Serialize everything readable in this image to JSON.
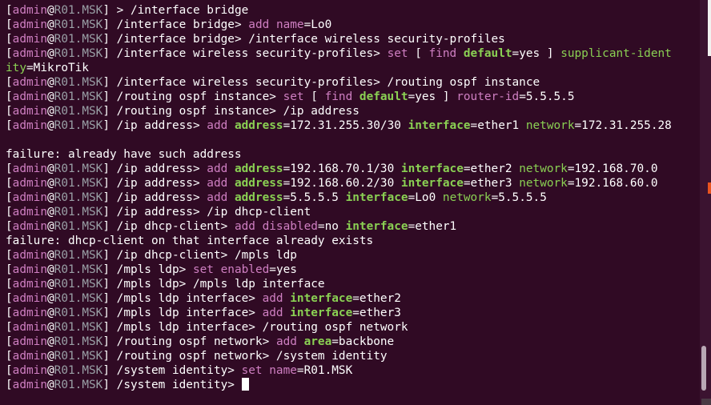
{
  "window": {
    "colors": {
      "background": "#300a24",
      "user": "#cf7fc2",
      "host": "#9aa0a6",
      "keyword": "#8ad053",
      "text": "#ffffff"
    }
  },
  "terminal": {
    "lines": [
      [
        [
          "w",
          "["
        ],
        [
          "u",
          "admin"
        ],
        [
          "w",
          "@"
        ],
        [
          "h",
          "R01.MSK"
        ],
        [
          "w",
          "] > /interface bridge"
        ]
      ],
      [
        [
          "w",
          "["
        ],
        [
          "u",
          "admin"
        ],
        [
          "w",
          "@"
        ],
        [
          "h",
          "R01.MSK"
        ],
        [
          "w",
          "] /interface bridge> "
        ],
        [
          "u",
          "add "
        ],
        [
          "u",
          "name"
        ],
        [
          "w",
          "=Lo0"
        ]
      ],
      [
        [
          "w",
          "["
        ],
        [
          "u",
          "admin"
        ],
        [
          "w",
          "@"
        ],
        [
          "h",
          "R01.MSK"
        ],
        [
          "w",
          "] /interface bridge> /interface wireless security-profiles"
        ]
      ],
      [
        [
          "w",
          "["
        ],
        [
          "u",
          "admin"
        ],
        [
          "w",
          "@"
        ],
        [
          "h",
          "R01.MSK"
        ],
        [
          "w",
          "] /interface wireless security-profiles> "
        ],
        [
          "u",
          "set "
        ],
        [
          "w",
          "[ "
        ],
        [
          "u",
          "find "
        ],
        [
          "k",
          "default"
        ],
        [
          "w",
          "=yes ] "
        ],
        [
          "g",
          "supplicant-ident"
        ]
      ],
      [
        [
          "g",
          "ity"
        ],
        [
          "w",
          "=MikroTik"
        ]
      ],
      [
        [
          "w",
          "["
        ],
        [
          "u",
          "admin"
        ],
        [
          "w",
          "@"
        ],
        [
          "h",
          "R01.MSK"
        ],
        [
          "w",
          "] /interface wireless security-profiles> /routing ospf instance"
        ]
      ],
      [
        [
          "w",
          "["
        ],
        [
          "u",
          "admin"
        ],
        [
          "w",
          "@"
        ],
        [
          "h",
          "R01.MSK"
        ],
        [
          "w",
          "] /routing ospf instance> "
        ],
        [
          "u",
          "set "
        ],
        [
          "w",
          "[ "
        ],
        [
          "u",
          "find "
        ],
        [
          "k",
          "default"
        ],
        [
          "w",
          "=yes ] "
        ],
        [
          "u",
          "router-id"
        ],
        [
          "w",
          "=5.5.5.5"
        ]
      ],
      [
        [
          "w",
          "["
        ],
        [
          "u",
          "admin"
        ],
        [
          "w",
          "@"
        ],
        [
          "h",
          "R01.MSK"
        ],
        [
          "w",
          "] /routing ospf instance> /ip address"
        ]
      ],
      [
        [
          "w",
          "["
        ],
        [
          "u",
          "admin"
        ],
        [
          "w",
          "@"
        ],
        [
          "h",
          "R01.MSK"
        ],
        [
          "w",
          "] /ip address> "
        ],
        [
          "u",
          "add "
        ],
        [
          "k",
          "address"
        ],
        [
          "w",
          "=172.31.255.30/30 "
        ],
        [
          "k",
          "interface"
        ],
        [
          "w",
          "=ether1 "
        ],
        [
          "g",
          "network"
        ],
        [
          "w",
          "=172.31.255.28"
        ]
      ],
      [
        [
          "w",
          " "
        ]
      ],
      [
        [
          "w",
          "failure: already have such address"
        ]
      ],
      [
        [
          "w",
          "["
        ],
        [
          "u",
          "admin"
        ],
        [
          "w",
          "@"
        ],
        [
          "h",
          "R01.MSK"
        ],
        [
          "w",
          "] /ip address> "
        ],
        [
          "u",
          "add "
        ],
        [
          "k",
          "address"
        ],
        [
          "w",
          "=192.168.70.1/30 "
        ],
        [
          "k",
          "interface"
        ],
        [
          "w",
          "=ether2 "
        ],
        [
          "g",
          "network"
        ],
        [
          "w",
          "=192.168.70.0"
        ]
      ],
      [
        [
          "w",
          "["
        ],
        [
          "u",
          "admin"
        ],
        [
          "w",
          "@"
        ],
        [
          "h",
          "R01.MSK"
        ],
        [
          "w",
          "] /ip address> "
        ],
        [
          "u",
          "add "
        ],
        [
          "k",
          "address"
        ],
        [
          "w",
          "=192.168.60.2/30 "
        ],
        [
          "k",
          "interface"
        ],
        [
          "w",
          "=ether3 "
        ],
        [
          "g",
          "network"
        ],
        [
          "w",
          "=192.168.60.0"
        ]
      ],
      [
        [
          "w",
          "["
        ],
        [
          "u",
          "admin"
        ],
        [
          "w",
          "@"
        ],
        [
          "h",
          "R01.MSK"
        ],
        [
          "w",
          "] /ip address> "
        ],
        [
          "u",
          "add "
        ],
        [
          "k",
          "address"
        ],
        [
          "w",
          "=5.5.5.5 "
        ],
        [
          "k",
          "interface"
        ],
        [
          "w",
          "=Lo0 "
        ],
        [
          "g",
          "network"
        ],
        [
          "w",
          "=5.5.5.5"
        ]
      ],
      [
        [
          "w",
          "["
        ],
        [
          "u",
          "admin"
        ],
        [
          "w",
          "@"
        ],
        [
          "h",
          "R01.MSK"
        ],
        [
          "w",
          "] /ip address> /ip dhcp-client"
        ]
      ],
      [
        [
          "w",
          "["
        ],
        [
          "u",
          "admin"
        ],
        [
          "w",
          "@"
        ],
        [
          "h",
          "R01.MSK"
        ],
        [
          "w",
          "] /ip dhcp-client> "
        ],
        [
          "u",
          "add "
        ],
        [
          "u",
          "disabled"
        ],
        [
          "w",
          "=no "
        ],
        [
          "k",
          "interface"
        ],
        [
          "w",
          "=ether1"
        ]
      ],
      [
        [
          "w",
          "failure: dhcp-client on that interface already exists"
        ]
      ],
      [
        [
          "w",
          "["
        ],
        [
          "u",
          "admin"
        ],
        [
          "w",
          "@"
        ],
        [
          "h",
          "R01.MSK"
        ],
        [
          "w",
          "] /ip dhcp-client> /mpls ldp"
        ]
      ],
      [
        [
          "w",
          "["
        ],
        [
          "u",
          "admin"
        ],
        [
          "w",
          "@"
        ],
        [
          "h",
          "R01.MSK"
        ],
        [
          "w",
          "] /mpls ldp> "
        ],
        [
          "u",
          "set "
        ],
        [
          "u",
          "enabled"
        ],
        [
          "w",
          "=yes"
        ]
      ],
      [
        [
          "w",
          "["
        ],
        [
          "u",
          "admin"
        ],
        [
          "w",
          "@"
        ],
        [
          "h",
          "R01.MSK"
        ],
        [
          "w",
          "] /mpls ldp> /mpls ldp interface"
        ]
      ],
      [
        [
          "w",
          "["
        ],
        [
          "u",
          "admin"
        ],
        [
          "w",
          "@"
        ],
        [
          "h",
          "R01.MSK"
        ],
        [
          "w",
          "] /mpls ldp interface> "
        ],
        [
          "u",
          "add "
        ],
        [
          "k",
          "interface"
        ],
        [
          "w",
          "=ether2"
        ]
      ],
      [
        [
          "w",
          "["
        ],
        [
          "u",
          "admin"
        ],
        [
          "w",
          "@"
        ],
        [
          "h",
          "R01.MSK"
        ],
        [
          "w",
          "] /mpls ldp interface> "
        ],
        [
          "u",
          "add "
        ],
        [
          "k",
          "interface"
        ],
        [
          "w",
          "=ether3"
        ]
      ],
      [
        [
          "w",
          "["
        ],
        [
          "u",
          "admin"
        ],
        [
          "w",
          "@"
        ],
        [
          "h",
          "R01.MSK"
        ],
        [
          "w",
          "] /mpls ldp interface> /routing ospf network"
        ]
      ],
      [
        [
          "w",
          "["
        ],
        [
          "u",
          "admin"
        ],
        [
          "w",
          "@"
        ],
        [
          "h",
          "R01.MSK"
        ],
        [
          "w",
          "] /routing ospf network> "
        ],
        [
          "u",
          "add "
        ],
        [
          "k",
          "area"
        ],
        [
          "w",
          "=backbone"
        ]
      ],
      [
        [
          "w",
          "["
        ],
        [
          "u",
          "admin"
        ],
        [
          "w",
          "@"
        ],
        [
          "h",
          "R01.MSK"
        ],
        [
          "w",
          "] /routing ospf network> /system identity"
        ]
      ],
      [
        [
          "w",
          "["
        ],
        [
          "u",
          "admin"
        ],
        [
          "w",
          "@"
        ],
        [
          "h",
          "R01.MSK"
        ],
        [
          "w",
          "] /system identity> "
        ],
        [
          "u",
          "set "
        ],
        [
          "u",
          "name"
        ],
        [
          "w",
          "=R01.MSK"
        ]
      ],
      [
        [
          "w",
          "["
        ],
        [
          "u",
          "admin"
        ],
        [
          "w",
          "@"
        ],
        [
          "h",
          "R01.MSK"
        ],
        [
          "w",
          "] /system identity> "
        ],
        [
          "cursor",
          ""
        ]
      ]
    ]
  }
}
